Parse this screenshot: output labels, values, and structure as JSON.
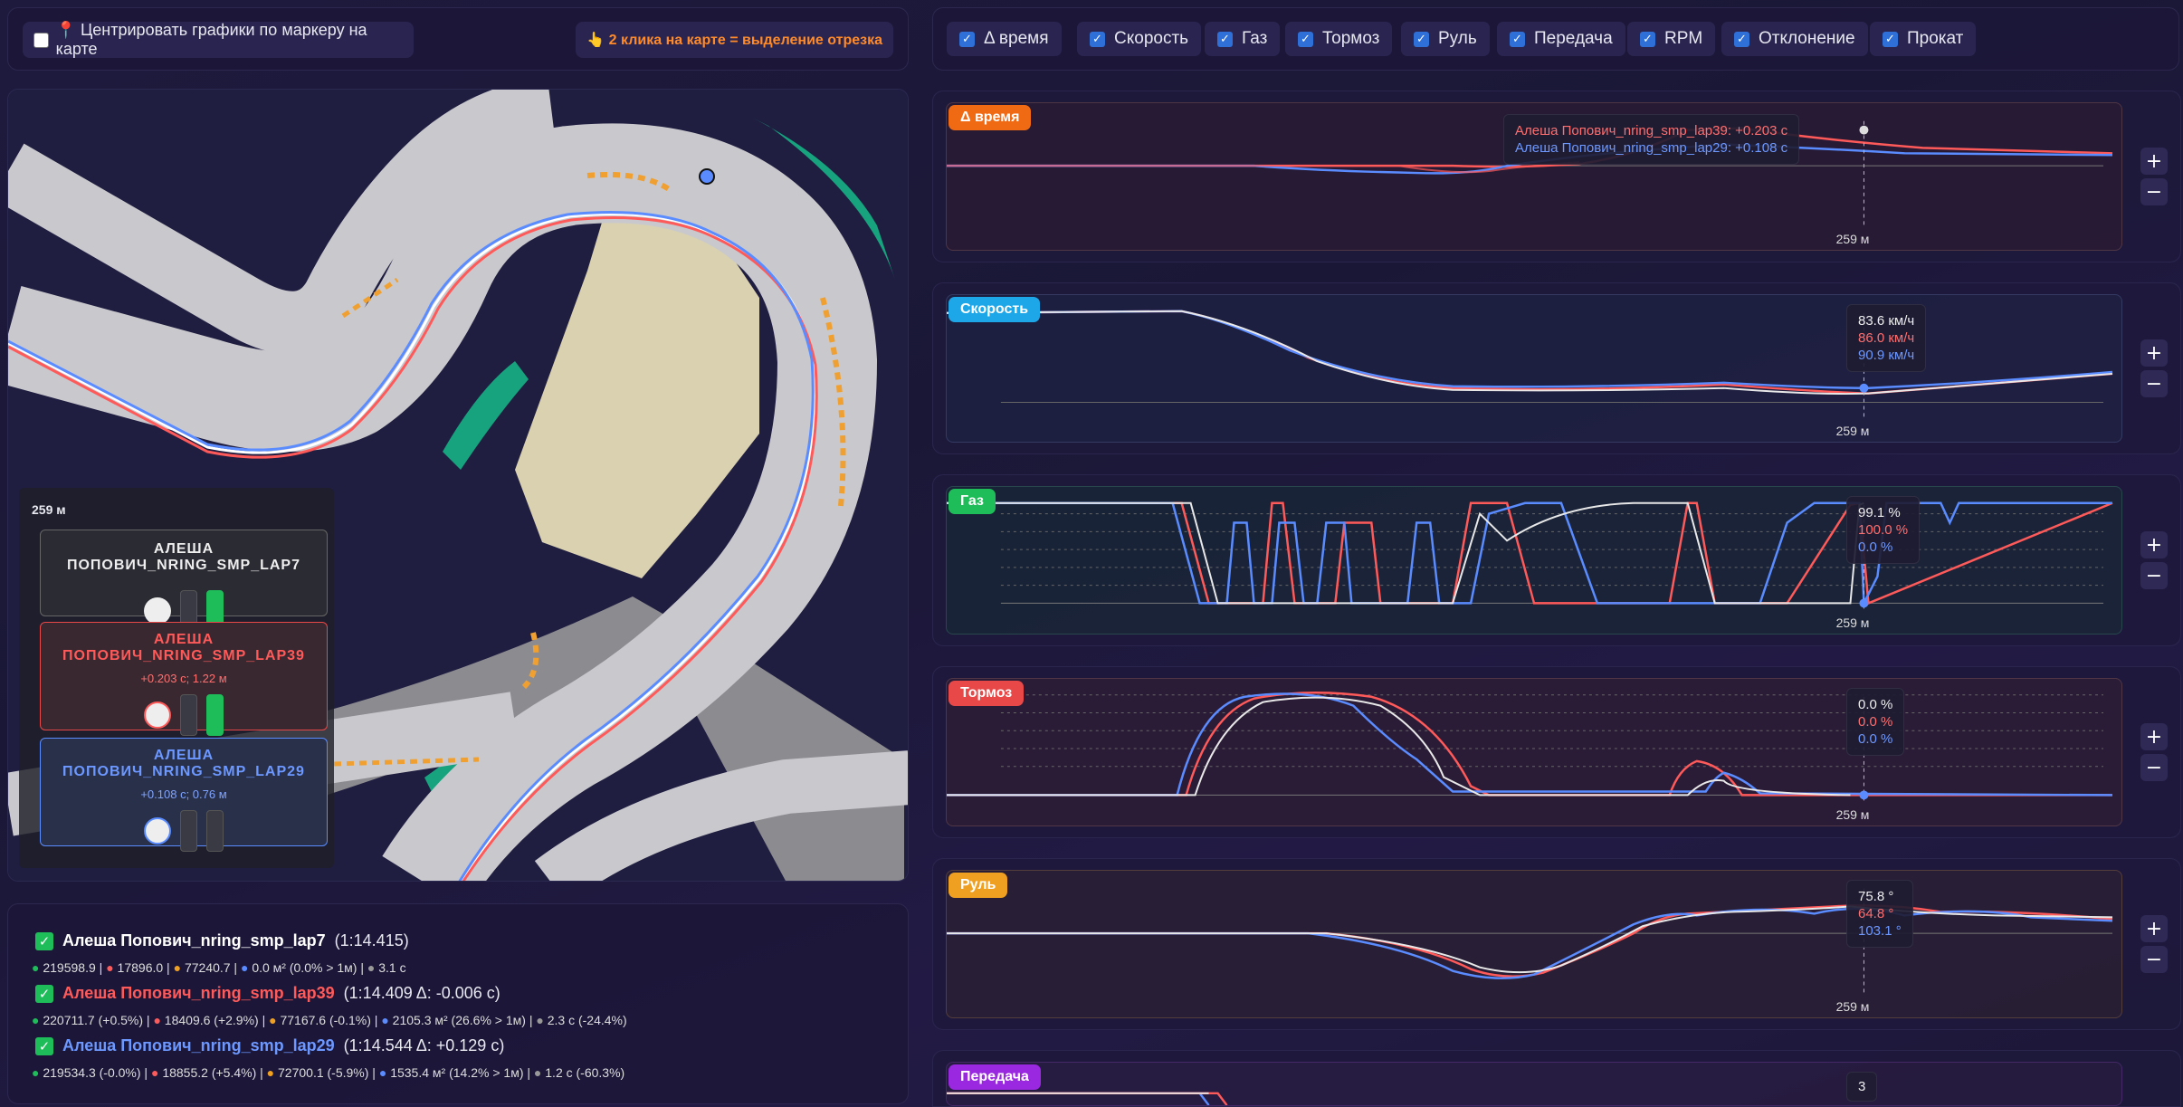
{
  "top_left": {
    "center_label": "📍 Центрировать графики по маркеру на карте",
    "hint": "👆 2 клика на карте = выделение отрезка"
  },
  "toggles": [
    "Δ время",
    "Скорость",
    "Газ",
    "Тормоз",
    "Руль",
    "Передача",
    "RPM",
    "Отклонение",
    "Прокат"
  ],
  "map": {
    "marker_distance": "259 м",
    "laps": [
      {
        "name": "АЛЕША ПОПОВИЧ_NRING_SMP_LAP7",
        "delta": "",
        "color": "#ffffff",
        "bar1": false,
        "bar2": true
      },
      {
        "name": "АЛЕША ПОПОВИЧ_NRING_SMP_LAP39",
        "delta": "+0.203 с; 1.22 м",
        "color": "#ff5a5a",
        "bar1": false,
        "bar2": true
      },
      {
        "name": "АЛЕША ПОПОВИЧ_NRING_SMP_LAP29",
        "delta": "+0.108 с; 0.76 м",
        "color": "#5b8cff",
        "bar1": false,
        "bar2": false
      }
    ]
  },
  "legend": [
    {
      "name": "Алеша Попович_nring_smp_lap7",
      "time": "(1:14.415)",
      "color": "#ffffff",
      "stats": [
        "219598.9",
        "17896.0",
        "77240.7",
        "0.0 м² (0.0% > 1м)",
        "3.1 с"
      ]
    },
    {
      "name": "Алеша Попович_nring_smp_lap39",
      "time": "(1:14.409 Δ: -0.006 с)",
      "color": "#ff5a5a",
      "stats": [
        "220711.7 (+0.5%)",
        "18409.6 (+2.9%)",
        "77167.6 (-0.1%)",
        "2105.3 м² (26.6% > 1м)",
        "2.3 с (-24.4%)"
      ]
    },
    {
      "name": "Алеша Попович_nring_smp_lap29",
      "time": "(1:14.544 Δ: +0.129 с)",
      "color": "#5b8cff",
      "stats": [
        "219534.3 (-0.0%)",
        "18855.2 (+5.4%)",
        "72700.1 (-5.9%)",
        "1535.4 м² (14.2% > 1м)",
        "1.2 с (-60.3%)"
      ]
    }
  ],
  "charts": {
    "delta": {
      "title": "Δ время",
      "color": "#f06a14",
      "marker": "259 м",
      "tip": [
        "Алеша Попович_nring_smp_lap39: +0.203 с",
        "Алеша Попович_nring_smp_lap29: +0.108 с"
      ]
    },
    "speed": {
      "title": "Скорость",
      "color": "#1ea7e8",
      "marker": "259 м",
      "tip": [
        "83.6 км/ч",
        "86.0 км/ч",
        "90.9 км/ч"
      ]
    },
    "gas": {
      "title": "Газ",
      "color": "#1fbd5a",
      "marker": "259 м",
      "tip": [
        "99.1 %",
        "100.0 %",
        "0.0 %"
      ]
    },
    "brake": {
      "title": "Тормоз",
      "color": "#e84848",
      "marker": "259 м",
      "tip": [
        "0.0 %",
        "0.0 %",
        "0.0 %"
      ]
    },
    "steer": {
      "title": "Руль",
      "color": "#f0a020",
      "marker": "259 м",
      "tip": [
        "75.8 °",
        "64.8 °",
        "103.1 °"
      ]
    },
    "gear": {
      "title": "Передача",
      "color": "#9a28e0",
      "tip": [
        "3"
      ]
    }
  },
  "colors": {
    "lap7": "#ffffff",
    "lap39": "#ff5a5a",
    "lap29": "#5b8cff"
  }
}
